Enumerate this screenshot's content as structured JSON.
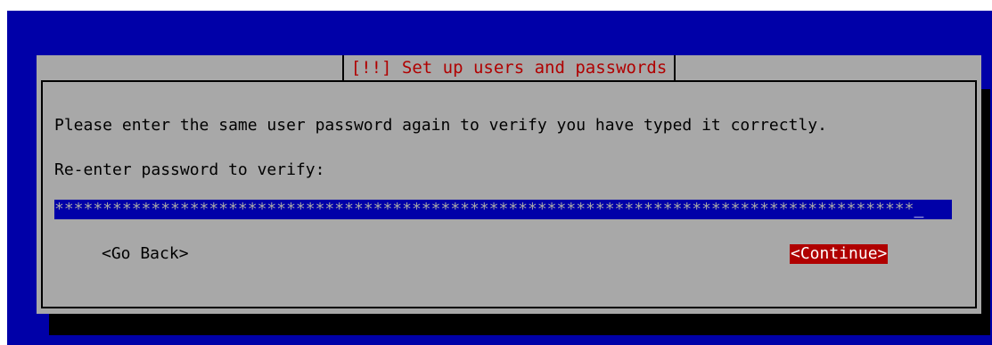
{
  "dialog": {
    "title": "[!!] Set up users and passwords",
    "message": "Please enter the same user password again to verify you have typed it correctly.",
    "prompt_label": "Re-enter password to verify:",
    "password_masked": "*****************************************************************************************",
    "cursor": "_"
  },
  "buttons": {
    "back_label": "<Go Back>",
    "continue_label": "<Continue>"
  },
  "colors": {
    "background": "#0000a8",
    "dialog": "#a8a8a8",
    "title": "#b00000",
    "focused_button": "#b00000"
  }
}
